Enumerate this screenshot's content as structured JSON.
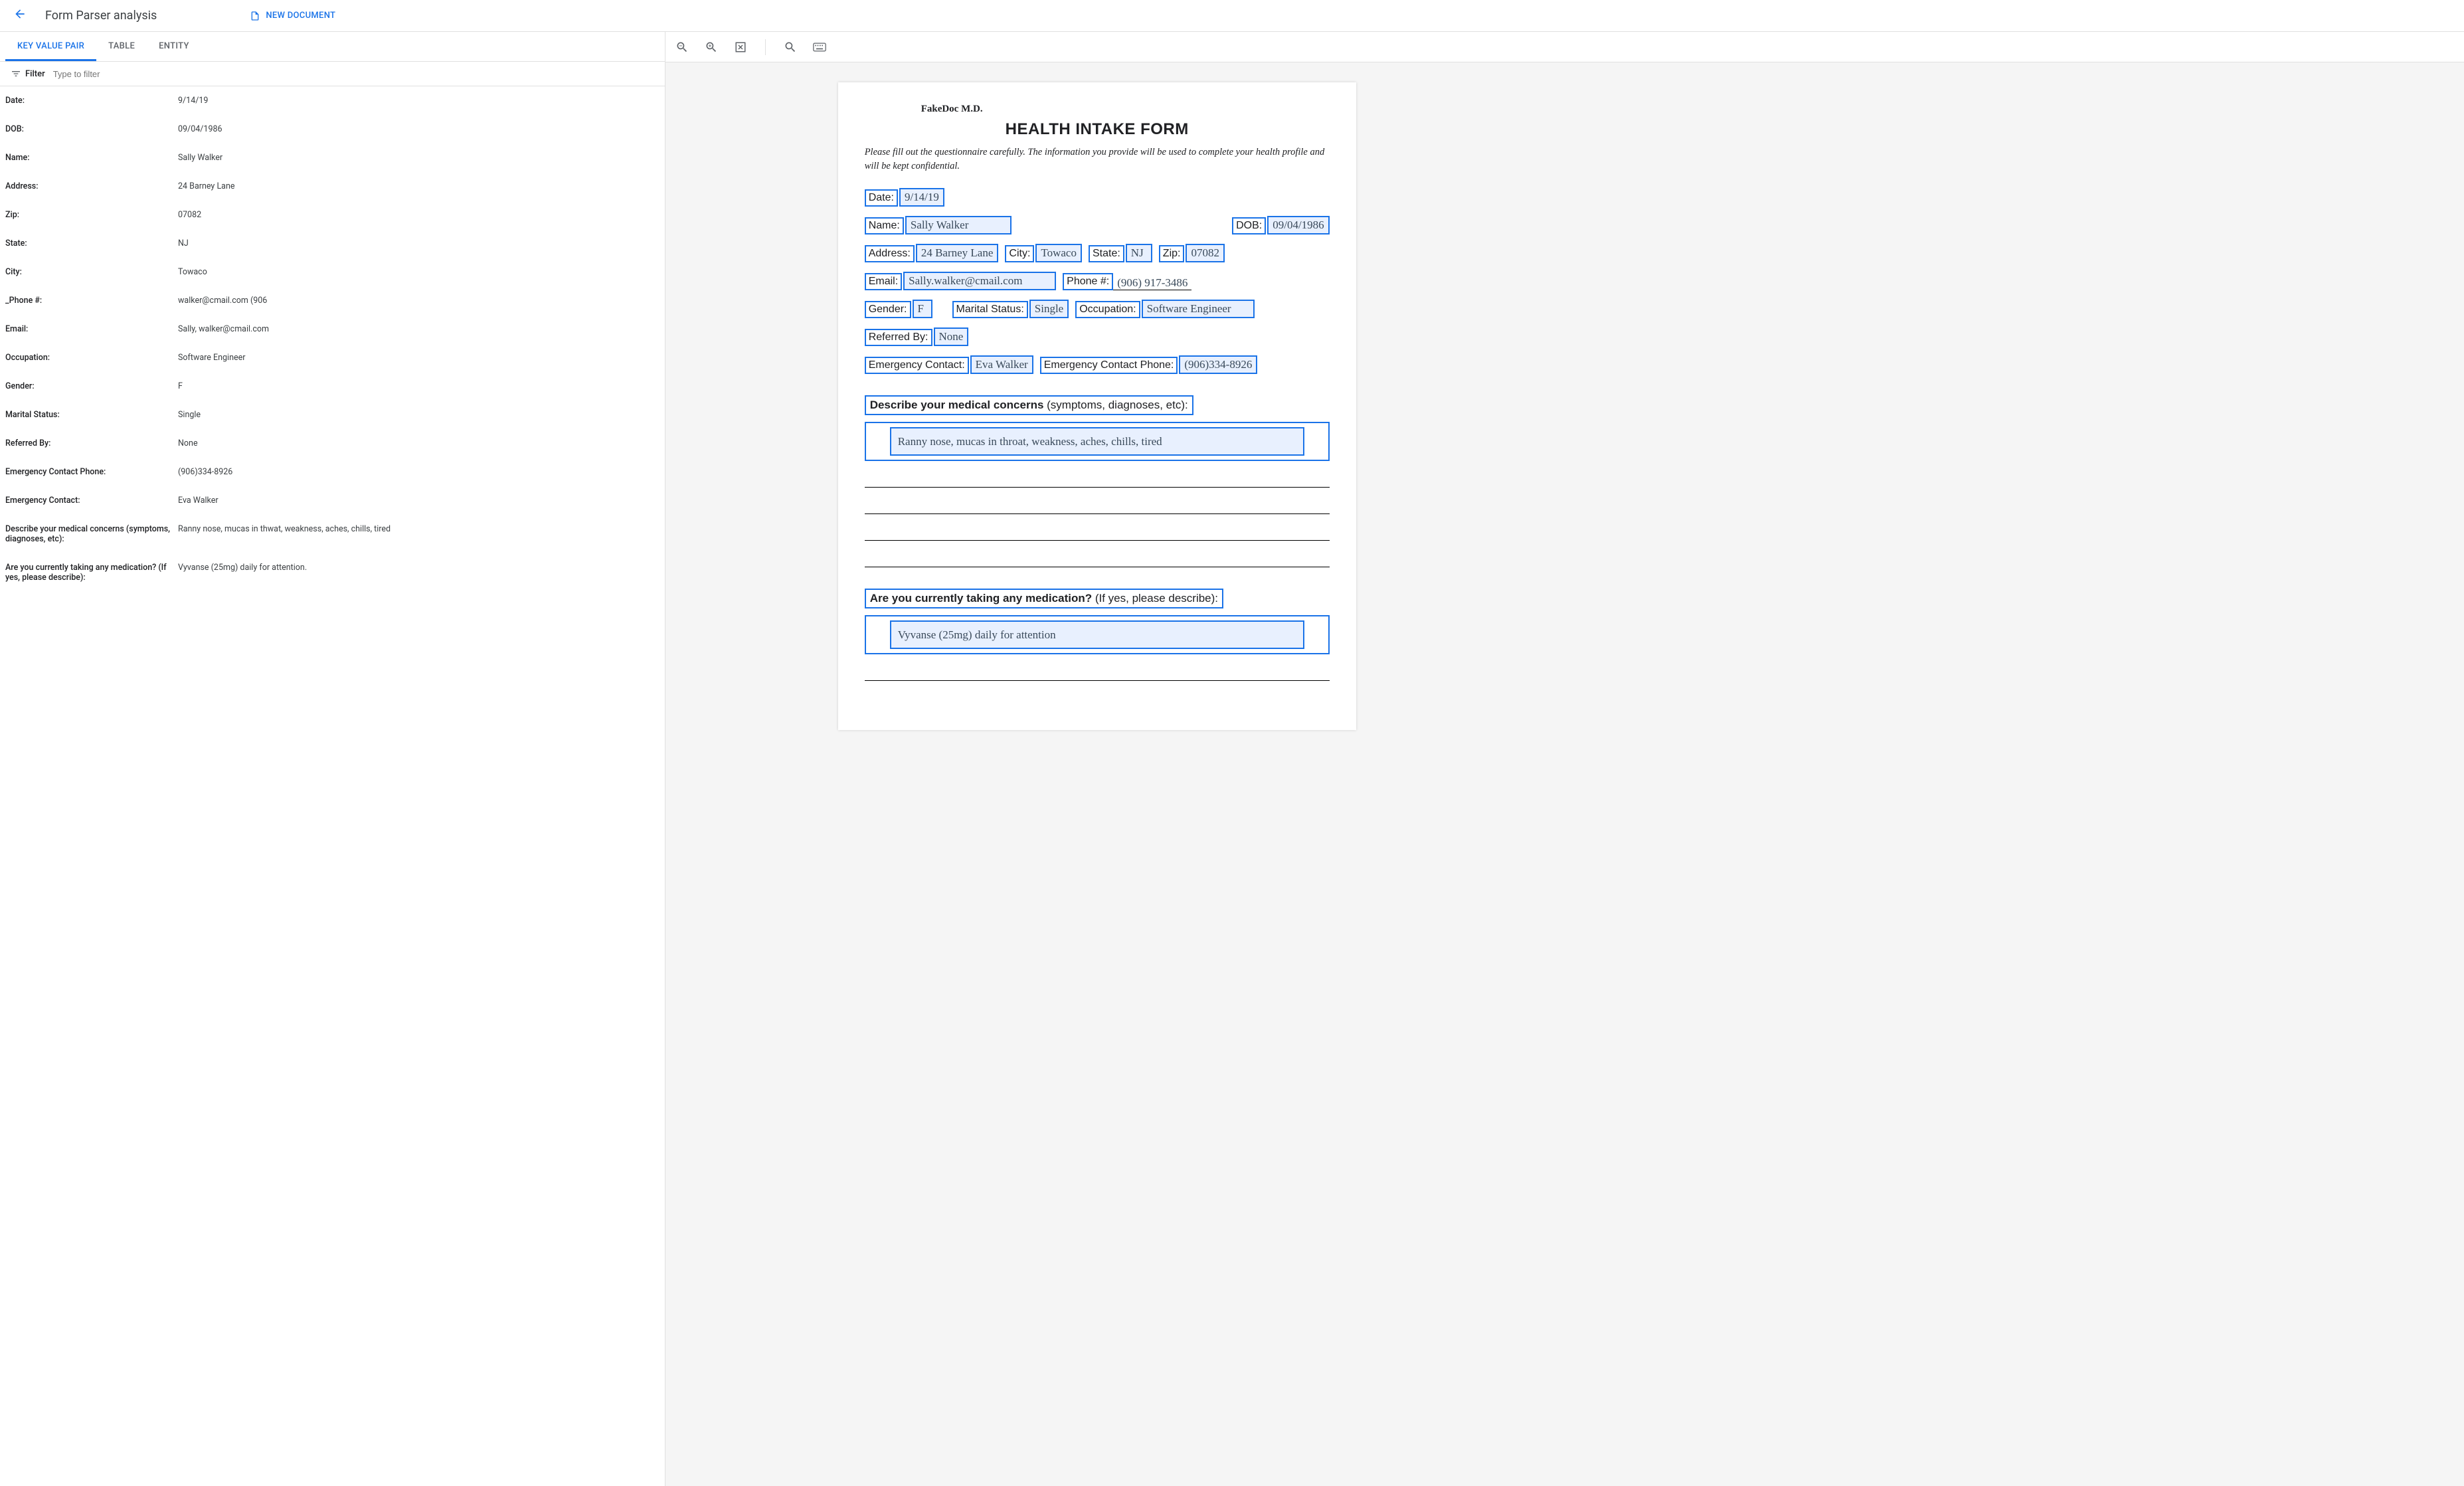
{
  "header": {
    "title": "Form Parser analysis",
    "new_document": "NEW DOCUMENT"
  },
  "tabs": {
    "kv": "KEY VALUE PAIR",
    "table": "TABLE",
    "entity": "ENTITY"
  },
  "filter": {
    "label": "Filter",
    "placeholder": "Type to filter"
  },
  "kv_pairs": [
    {
      "key": "Date:",
      "value": "9/14/19"
    },
    {
      "key": "DOB:",
      "value": "09/04/1986"
    },
    {
      "key": "Name:",
      "value": "Sally Walker"
    },
    {
      "key": "Address:",
      "value": "24 Barney Lane"
    },
    {
      "key": "Zip:",
      "value": "07082"
    },
    {
      "key": "State:",
      "value": "NJ"
    },
    {
      "key": "City:",
      "value": "Towaco"
    },
    {
      "key": "_Phone #:",
      "value": "walker@cmail.com (906"
    },
    {
      "key": "Email:",
      "value": "Sally, walker@cmail.com"
    },
    {
      "key": "Occupation:",
      "value": "Software Engineer"
    },
    {
      "key": "Gender:",
      "value": "F"
    },
    {
      "key": "Marital Status:",
      "value": "Single"
    },
    {
      "key": "Referred By:",
      "value": "None"
    },
    {
      "key": "Emergency Contact Phone:",
      "value": "(906)334-8926"
    },
    {
      "key": "Emergency Contact:",
      "value": "Eva Walker"
    },
    {
      "key": "Describe your medical concerns (symptoms, diagnoses, etc):",
      "value": "Ranny nose, mucas in thwat, weakness, aches, chills, tired"
    },
    {
      "key": "Are you currently taking any medication? (If yes, please describe):",
      "value": "Vyvanse (25mg) daily for attention."
    }
  ],
  "doc": {
    "provider": "FakeDoc M.D.",
    "title": "HEALTH INTAKE FORM",
    "instructions": "Please fill out the questionnaire carefully. The information you provide will be used to complete your health profile and will be kept confidential.",
    "labels": {
      "date": "Date:",
      "name": "Name:",
      "dob": "DOB:",
      "address": "Address:",
      "city": "City:",
      "state": "State:",
      "zip": "Zip:",
      "email": "Email:",
      "phone": "Phone #:",
      "gender": "Gender:",
      "marital": "Marital Status:",
      "occupation": "Occupation:",
      "referred": "Referred By:",
      "emc": "Emergency Contact:",
      "emcp": "Emergency Contact Phone:"
    },
    "values": {
      "date": "9/14/19",
      "name": "Sally Walker",
      "dob": "09/04/1986",
      "address": "24 Barney Lane",
      "city": "Towaco",
      "state": "NJ",
      "zip": "07082",
      "email": "Sally.walker@cmail.com",
      "phone": "(906) 917-3486",
      "gender": "F",
      "marital": "Single",
      "occupation": "Software Engineer",
      "referred": "None",
      "emc": "Eva Walker",
      "emcp": "(906)334-8926"
    },
    "section1": {
      "bold": "Describe your medical concerns",
      "rest": " (symptoms, diagnoses, etc):"
    },
    "concerns": "Ranny nose, mucas in throat, weakness, aches, chills, tired",
    "section2": {
      "bold": "Are you currently taking any medication?",
      "rest": " (If yes, please describe):"
    },
    "medication": "Vyvanse (25mg) daily for attention"
  }
}
